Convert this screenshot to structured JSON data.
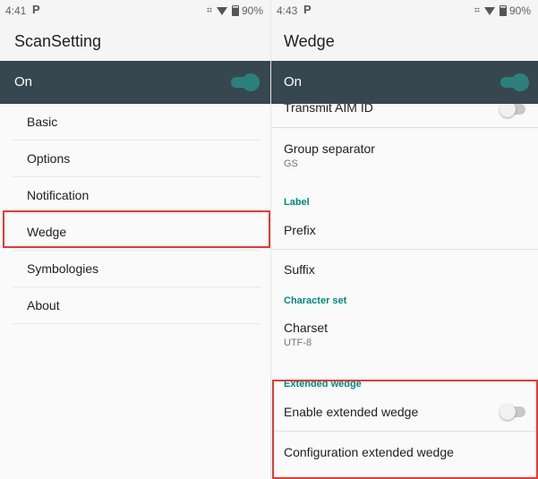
{
  "left": {
    "status": {
      "time": "4:41",
      "battery": "90%"
    },
    "title": "ScanSetting",
    "master_switch": {
      "label": "On",
      "state": "on"
    },
    "menu": [
      "Basic",
      "Options",
      "Notification",
      "Wedge",
      "Symbologies",
      "About"
    ],
    "highlighted_item": "Wedge"
  },
  "right": {
    "status": {
      "time": "4:43",
      "battery": "90%"
    },
    "title": "Wedge",
    "master_switch": {
      "label": "On",
      "state": "on"
    },
    "transmit_aim_id": {
      "label": "Transmit AIM ID",
      "state": "off"
    },
    "group_separator": {
      "label": "Group separator",
      "value": "GS"
    },
    "label_category": "Label",
    "prefix": "Prefix",
    "suffix": "Suffix",
    "charset_category": "Character set",
    "charset": {
      "label": "Charset",
      "value": "UTF-8"
    },
    "extended_category": "Extended wedge",
    "enable_extended": {
      "label": "Enable extended wedge",
      "state": "off"
    },
    "config_extended": "Configuration extended wedge"
  },
  "colors": {
    "accent": "#26a69a",
    "category": "#00897b",
    "bar": "#37474f",
    "highlight": "#e53935"
  }
}
